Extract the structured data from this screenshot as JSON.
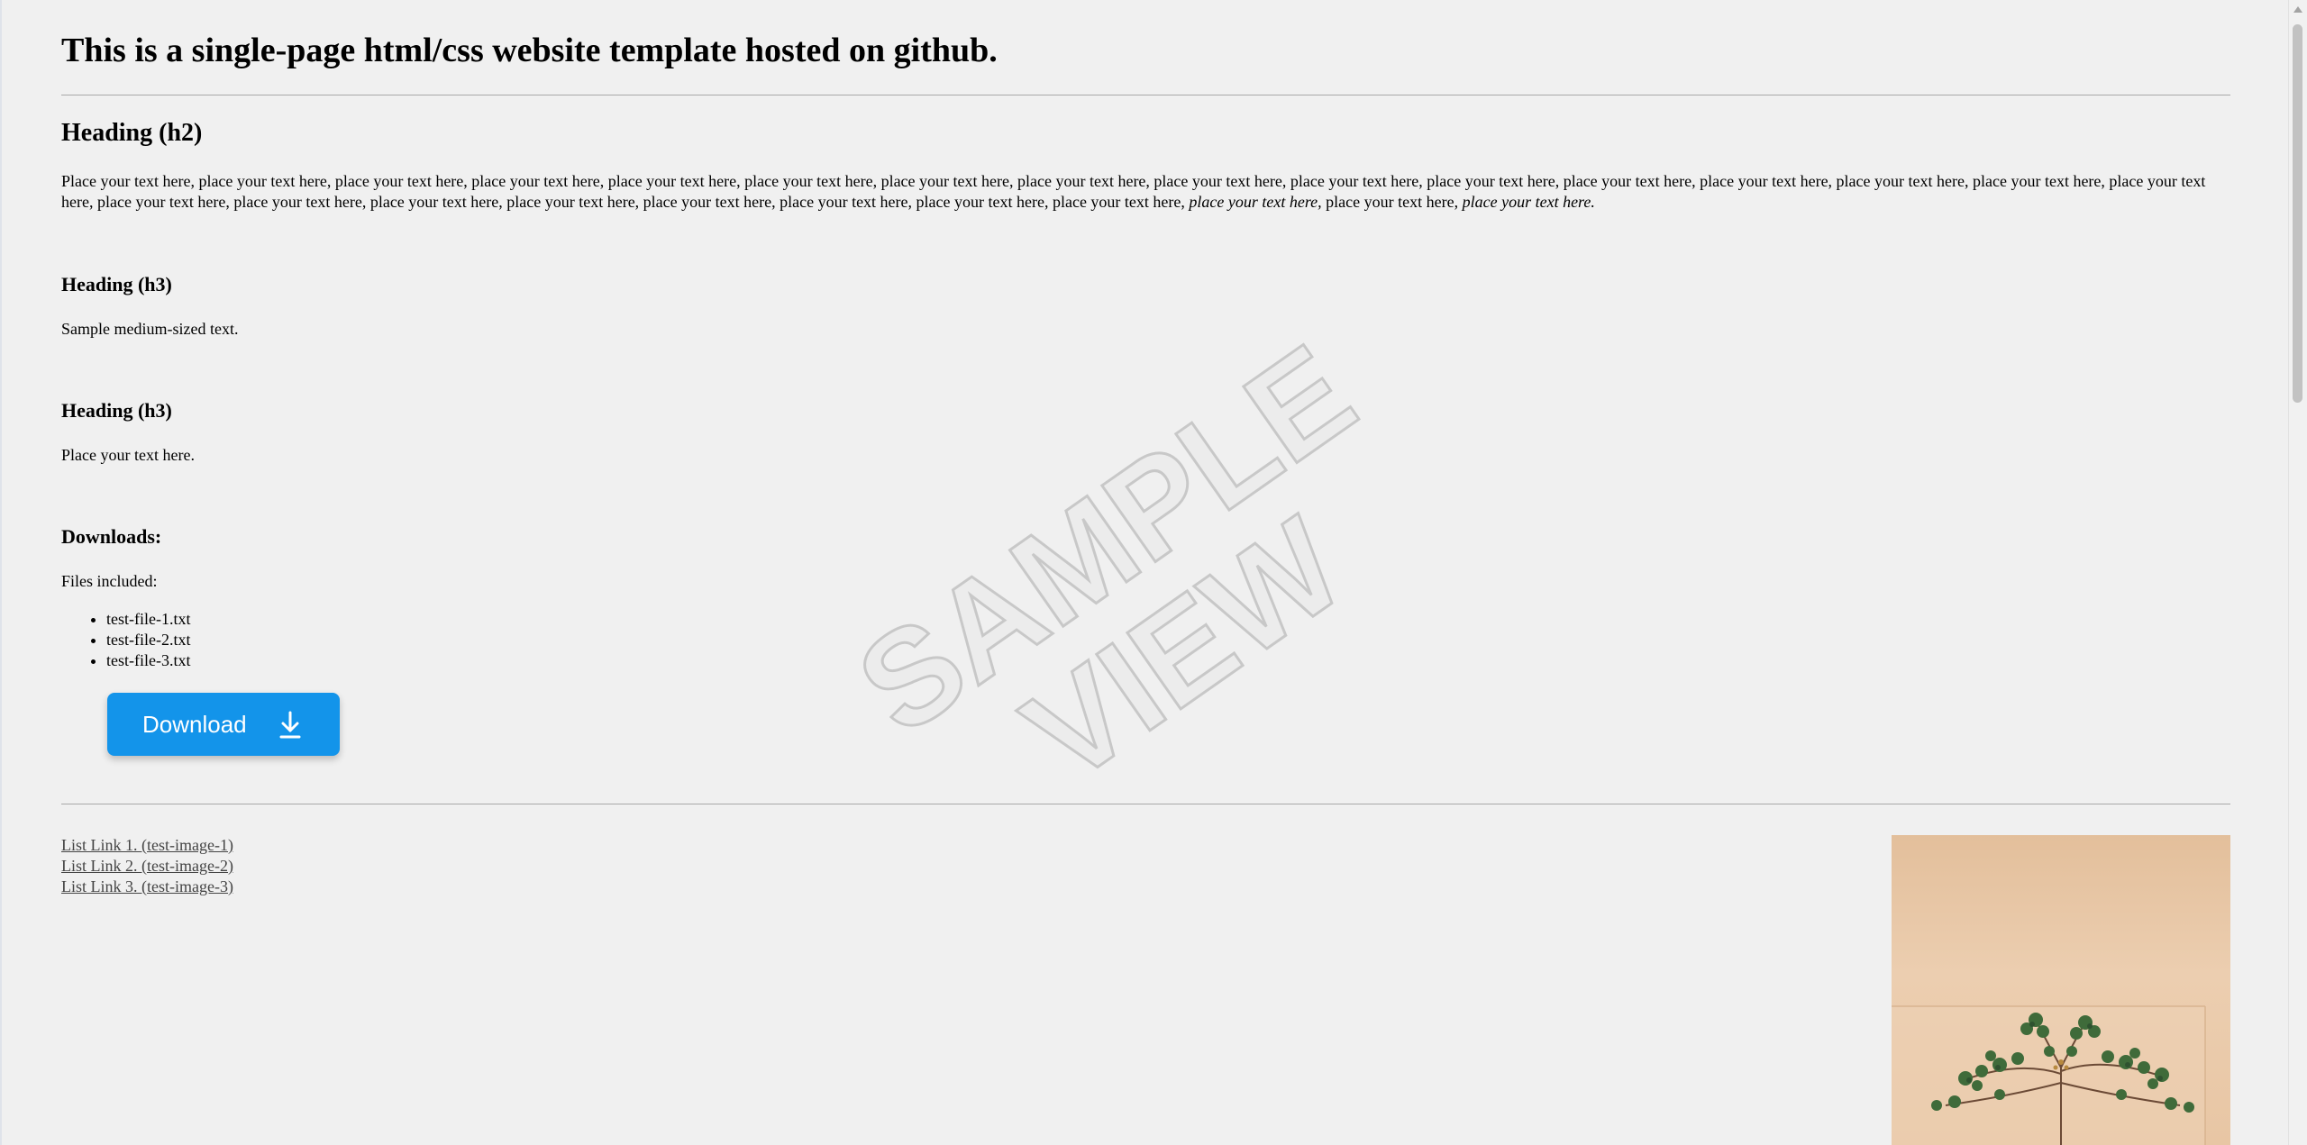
{
  "page": {
    "title": "This is a single-page html/css website template hosted on github.",
    "h2": "Heading (h2)",
    "intro": {
      "plain": "Place your text here, place your text here, place your text here, place your text here, place your text here, place your text here, place your text here, place your text here, place your text here, place your text here, place your text here, place your text here, place your text here, place your text here, place your text here, place your text here, place your text here, place your text here, place your text here, place your text here, place your text here, place your text here, place your text here, place your text here,",
      "italic1": "place your text here,",
      "plain2": "place your text here,",
      "italic2": "place your text here."
    }
  },
  "sections": [
    {
      "heading": "Heading (h3)",
      "text": "Sample medium-sized text."
    },
    {
      "heading": "Heading (h3)",
      "text": "Place your text here."
    }
  ],
  "downloads": {
    "heading": "Downloads:",
    "intro": "Files included:",
    "files": [
      "test-file-1.txt",
      "test-file-2.txt",
      "test-file-3.txt"
    ],
    "button_label": "Download",
    "button_color": "#1394ea",
    "icon": "download-arrow-icon"
  },
  "links": [
    "List Link 1. (test-image-1)",
    "List Link 2. (test-image-2)",
    "List Link 3. (test-image-3)"
  ],
  "watermark": {
    "line1": "SAMPLE",
    "line2": "VIEW"
  },
  "colors": {
    "background": "#f0f0f0",
    "rule": "#a8a8a8",
    "link": "#444444"
  }
}
